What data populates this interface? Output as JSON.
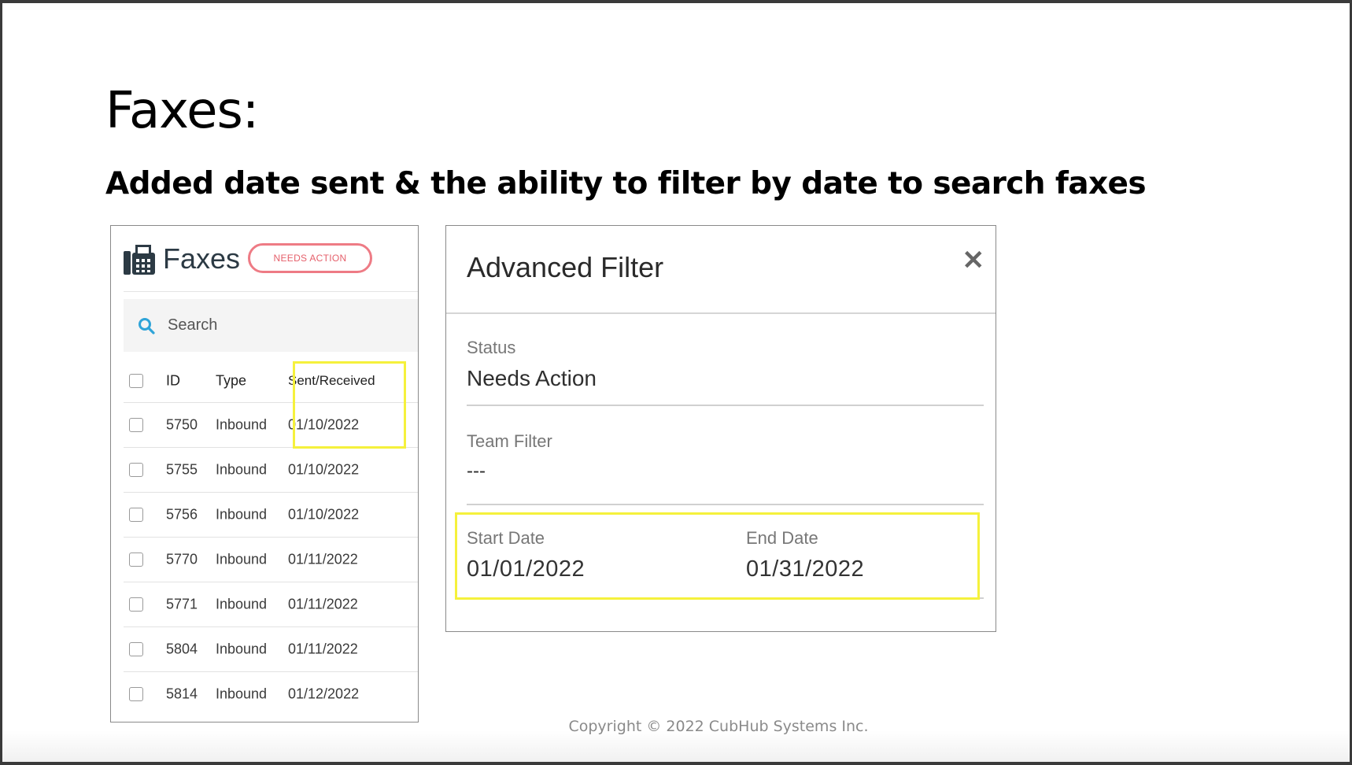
{
  "slide": {
    "title": "Faxes:",
    "subtitle": "Added date sent & the ability to filter by date to search faxes",
    "footer": "Copyright © 2022 CubHub Systems Inc.",
    "highlight_color": "#f5f13c"
  },
  "faxes_panel": {
    "title": "Faxes",
    "icon": "fax-icon",
    "badge": "NEEDS ACTION",
    "badge_color": "#ee7b85",
    "search_placeholder": "Search",
    "columns": [
      "ID",
      "Type",
      "Sent/Received"
    ],
    "rows": [
      {
        "id": "5750",
        "type": "Inbound",
        "date": "01/10/2022"
      },
      {
        "id": "5755",
        "type": "Inbound",
        "date": "01/10/2022"
      },
      {
        "id": "5756",
        "type": "Inbound",
        "date": "01/10/2022"
      },
      {
        "id": "5770",
        "type": "Inbound",
        "date": "01/11/2022"
      },
      {
        "id": "5771",
        "type": "Inbound",
        "date": "01/11/2022"
      },
      {
        "id": "5804",
        "type": "Inbound",
        "date": "01/11/2022"
      },
      {
        "id": "5814",
        "type": "Inbound",
        "date": "01/12/2022"
      }
    ]
  },
  "filter_panel": {
    "title": "Advanced Filter",
    "close_icon": "close-icon",
    "status_label": "Status",
    "status_value": "Needs Action",
    "team_label": "Team Filter",
    "team_value": "---",
    "start_label": "Start Date",
    "start_value": "01/01/2022",
    "end_label": "End Date",
    "end_value": "01/31/2022"
  }
}
